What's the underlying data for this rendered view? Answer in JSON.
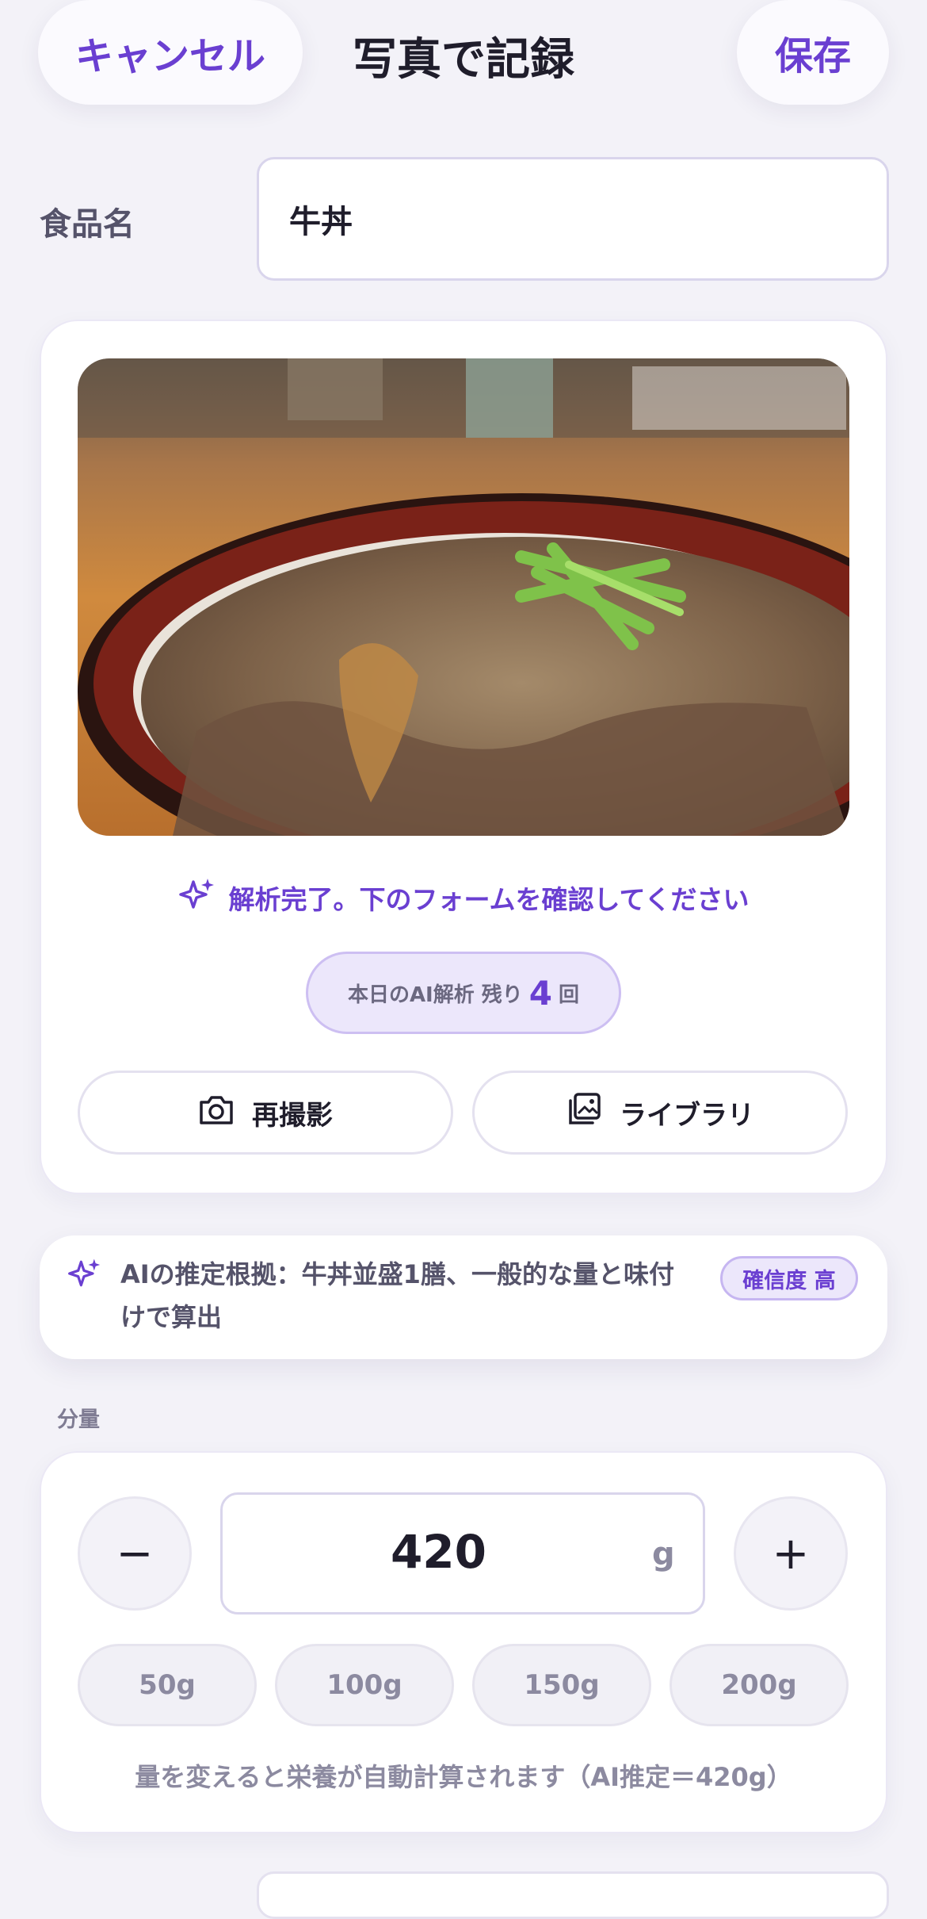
{
  "header": {
    "cancel_label": "キャンセル",
    "title": "写真で記録",
    "save_label": "保存"
  },
  "food": {
    "label": "食品名",
    "value": "牛丼"
  },
  "photo_card": {
    "status_icon": "sparkle-icon",
    "status_text": "解析完了。下のフォームを確認してください",
    "remaining_prefix": "本日のAI解析 残り",
    "remaining_count": "4",
    "remaining_suffix": "回",
    "retake_icon": "camera-icon",
    "retake_label": "再撮影",
    "library_icon": "photo-library-icon",
    "library_label": "ライブラリ"
  },
  "ai_reason": {
    "icon": "sparkle-icon",
    "text": "AIの推定根拠：牛丼並盛1膳、一般的な量と味付けで算出",
    "confidence": "確信度 高"
  },
  "quantity": {
    "section_label": "分量",
    "minus": "−",
    "plus": "+",
    "value": "420",
    "unit": "g",
    "presets": [
      "50g",
      "100g",
      "150g",
      "200g"
    ],
    "hint": "量を変えると栄養が自動計算されます（AI推定＝420g）"
  },
  "colors": {
    "accent": "#6a3fd1",
    "background": "#f3f2f8"
  }
}
